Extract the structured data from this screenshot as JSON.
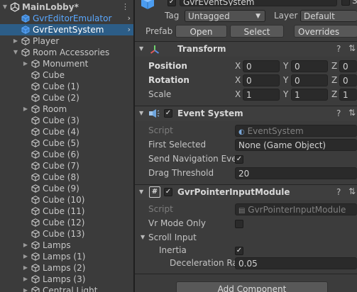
{
  "hierarchy": {
    "scene_name": "MainLobby*",
    "items": [
      {
        "label": "GvrEditorEmulator",
        "indent": 1,
        "expandable": false,
        "selected": false,
        "prefab": true
      },
      {
        "label": "GvrEventSystem",
        "indent": 1,
        "expandable": false,
        "selected": true,
        "prefab": true
      },
      {
        "label": "Player",
        "indent": 1,
        "expandable": true,
        "expanded": false,
        "selected": false,
        "prefab": false
      },
      {
        "label": "Room Accessories",
        "indent": 1,
        "expandable": true,
        "expanded": true,
        "selected": false,
        "prefab": false
      },
      {
        "label": "Monument",
        "indent": 2,
        "expandable": true,
        "expanded": false,
        "selected": false,
        "prefab": false
      },
      {
        "label": "Cube",
        "indent": 2,
        "expandable": false,
        "selected": false,
        "prefab": false
      },
      {
        "label": "Cube (1)",
        "indent": 2,
        "expandable": false,
        "selected": false,
        "prefab": false
      },
      {
        "label": "Cube (2)",
        "indent": 2,
        "expandable": false,
        "selected": false,
        "prefab": false
      },
      {
        "label": "Room",
        "indent": 2,
        "expandable": true,
        "expanded": false,
        "selected": false,
        "prefab": false
      },
      {
        "label": "Cube (3)",
        "indent": 2,
        "expandable": false,
        "selected": false,
        "prefab": false
      },
      {
        "label": "Cube (4)",
        "indent": 2,
        "expandable": false,
        "selected": false,
        "prefab": false
      },
      {
        "label": "Cube (5)",
        "indent": 2,
        "expandable": false,
        "selected": false,
        "prefab": false
      },
      {
        "label": "Cube (6)",
        "indent": 2,
        "expandable": false,
        "selected": false,
        "prefab": false
      },
      {
        "label": "Cube (7)",
        "indent": 2,
        "expandable": false,
        "selected": false,
        "prefab": false
      },
      {
        "label": "Cube (8)",
        "indent": 2,
        "expandable": false,
        "selected": false,
        "prefab": false
      },
      {
        "label": "Cube (9)",
        "indent": 2,
        "expandable": false,
        "selected": false,
        "prefab": false
      },
      {
        "label": "Cube (10)",
        "indent": 2,
        "expandable": false,
        "selected": false,
        "prefab": false
      },
      {
        "label": "Cube (11)",
        "indent": 2,
        "expandable": false,
        "selected": false,
        "prefab": false
      },
      {
        "label": "Cube (12)",
        "indent": 2,
        "expandable": false,
        "selected": false,
        "prefab": false
      },
      {
        "label": "Cube (13)",
        "indent": 2,
        "expandable": false,
        "selected": false,
        "prefab": false
      },
      {
        "label": "Lamps",
        "indent": 2,
        "expandable": true,
        "expanded": false,
        "selected": false,
        "prefab": false
      },
      {
        "label": "Lamps (1)",
        "indent": 2,
        "expandable": true,
        "expanded": false,
        "selected": false,
        "prefab": false
      },
      {
        "label": "Lamps (2)",
        "indent": 2,
        "expandable": true,
        "expanded": false,
        "selected": false,
        "prefab": false
      },
      {
        "label": "Lamps (3)",
        "indent": 2,
        "expandable": true,
        "expanded": false,
        "selected": false,
        "prefab": false
      },
      {
        "label": "Central Light",
        "indent": 2,
        "expandable": true,
        "expanded": false,
        "selected": false,
        "prefab": false
      }
    ]
  },
  "inspector": {
    "object_name": "GvrEventSystem",
    "static_label": "St",
    "tag_label": "Tag",
    "tag_value": "Untagged",
    "layer_label": "Layer",
    "layer_value": "Default",
    "prefab_label": "Prefab",
    "prefab_open": "Open",
    "prefab_select": "Select",
    "prefab_overrides": "Overrides",
    "transform": {
      "title": "Transform",
      "position_label": "Position",
      "rotation_label": "Rotation",
      "scale_label": "Scale",
      "position": {
        "x": "0",
        "y": "0",
        "z": "0"
      },
      "rotation": {
        "x": "0",
        "y": "0",
        "z": "0"
      },
      "scale": {
        "x": "1",
        "y": "1",
        "z": "1"
      },
      "axis_x": "X",
      "axis_y": "Y",
      "axis_z": "Z"
    },
    "event_system": {
      "title": "Event System",
      "script_label": "Script",
      "script_value": "EventSystem",
      "first_selected_label": "First Selected",
      "first_selected_value": "None (Game Object)",
      "send_nav_label": "Send Navigation Ever",
      "send_nav_checked": true,
      "drag_threshold_label": "Drag Threshold",
      "drag_threshold_value": "20"
    },
    "pointer_module": {
      "title": "GvrPointerInputModule",
      "script_label": "Script",
      "script_value": "GvrPointerInputModule",
      "vr_mode_label": "Vr Mode Only",
      "vr_mode_checked": false,
      "scroll_input_label": "Scroll Input",
      "inertia_label": "Inertia",
      "inertia_checked": true,
      "deceleration_label": "Deceleration Ra",
      "deceleration_value": "0.05"
    },
    "add_component": "Add Component"
  },
  "colors": {
    "selection": "#2c5d87",
    "prefab_blue": "#5aa8ff",
    "panel_bg": "#3c3c3c",
    "field_bg": "#2a2a2a"
  }
}
